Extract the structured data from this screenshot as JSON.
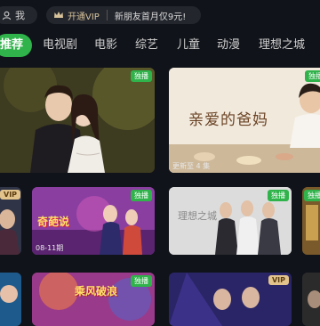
{
  "topbar": {
    "me_label": "我",
    "vip_label": "开通VIP",
    "promo_text": "新朋友首月仅9元!"
  },
  "nav": {
    "items": [
      "推荐",
      "电视剧",
      "电影",
      "综艺",
      "儿童",
      "动漫",
      "理想之城"
    ]
  },
  "hero": {
    "left": {
      "badge": "独播"
    },
    "right": {
      "badge": "独播",
      "title_art": "亲爱的爸妈",
      "episode": "更新至 4 集"
    }
  },
  "row2": {
    "left_badge": "VIP",
    "card1": {
      "badge": "独播",
      "art_text": "奇葩说",
      "episode": "08-11期"
    },
    "card2": {
      "badge": "独播",
      "art_text": "理想之城"
    },
    "card3_badge": "独播"
  },
  "row3": {
    "card1": {
      "badge": "独播",
      "art_text": "乘风破浪"
    },
    "card2": {
      "badge": "VIP"
    }
  },
  "colors": {
    "accent": "#2fb34a",
    "background": "#101319",
    "vip_gold": "#e3c38c"
  }
}
